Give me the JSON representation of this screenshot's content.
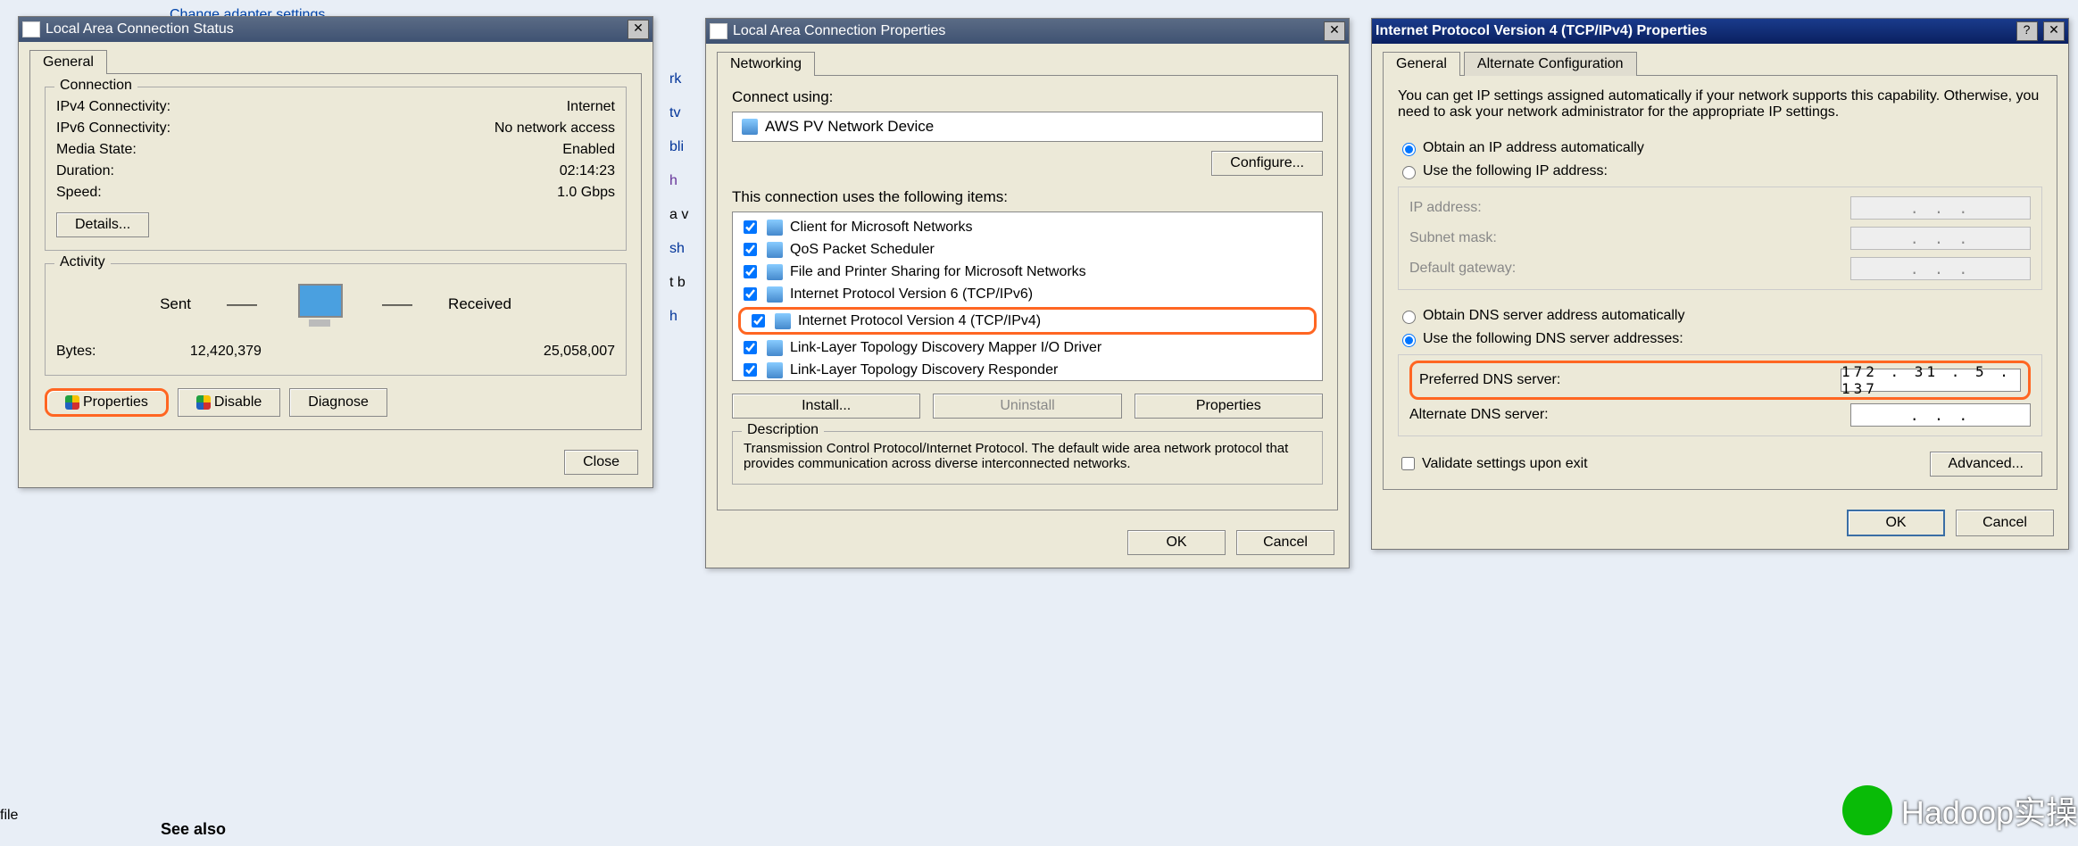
{
  "background": {
    "adapter_link": "Change adapter settings",
    "see_also": "See also",
    "file": "file",
    "watermark": "Hadoop实操"
  },
  "side_frag": [
    "rk",
    "tv",
    "bli",
    "h",
    "a v",
    "sh",
    "t b",
    "h"
  ],
  "status": {
    "title": "Local Area Connection Status",
    "tab_general": "General",
    "group_connection": "Connection",
    "ipv4_label": "IPv4 Connectivity:",
    "ipv4_value": "Internet",
    "ipv6_label": "IPv6 Connectivity:",
    "ipv6_value": "No network access",
    "media_label": "Media State:",
    "media_value": "Enabled",
    "duration_label": "Duration:",
    "duration_value": "02:14:23",
    "speed_label": "Speed:",
    "speed_value": "1.0 Gbps",
    "details_btn": "Details...",
    "group_activity": "Activity",
    "sent": "Sent",
    "received": "Received",
    "bytes_label": "Bytes:",
    "bytes_sent": "12,420,379",
    "bytes_received": "25,058,007",
    "properties_btn": "Properties",
    "disable_btn": "Disable",
    "diagnose_btn": "Diagnose",
    "close_btn": "Close"
  },
  "props": {
    "title": "Local Area Connection Properties",
    "tab_networking": "Networking",
    "connect_using": "Connect using:",
    "device": "AWS PV Network Device",
    "configure_btn": "Configure...",
    "uses_label": "This connection uses the following items:",
    "items": [
      "Client for Microsoft Networks",
      "QoS Packet Scheduler",
      "File and Printer Sharing for Microsoft Networks",
      "Internet Protocol Version 6 (TCP/IPv6)",
      "Internet Protocol Version 4 (TCP/IPv4)",
      "Link-Layer Topology Discovery Mapper I/O Driver",
      "Link-Layer Topology Discovery Responder"
    ],
    "install_btn": "Install...",
    "uninstall_btn": "Uninstall",
    "properties_btn": "Properties",
    "desc_title": "Description",
    "desc_text": "Transmission Control Protocol/Internet Protocol. The default wide area network protocol that provides communication across diverse interconnected networks.",
    "ok_btn": "OK",
    "cancel_btn": "Cancel"
  },
  "ipv4": {
    "title": "Internet Protocol Version 4 (TCP/IPv4) Properties",
    "tab_general": "General",
    "tab_alt": "Alternate Configuration",
    "intro": "You can get IP settings assigned automatically if your network supports this capability. Otherwise, you need to ask your network administrator for the appropriate IP settings.",
    "obtain_ip": "Obtain an IP address automatically",
    "use_ip": "Use the following IP address:",
    "ip_label": "IP address:",
    "subnet_label": "Subnet mask:",
    "gateway_label": "Default gateway:",
    "obtain_dns": "Obtain DNS server address automatically",
    "use_dns": "Use the following DNS server addresses:",
    "pref_dns_label": "Preferred DNS server:",
    "pref_dns_value": "172 . 31 .  5 . 137",
    "alt_dns_label": "Alternate DNS server:",
    "alt_dns_value": ".       .       .",
    "validate": "Validate settings upon exit",
    "advanced_btn": "Advanced...",
    "ok_btn": "OK",
    "cancel_btn": "Cancel"
  }
}
